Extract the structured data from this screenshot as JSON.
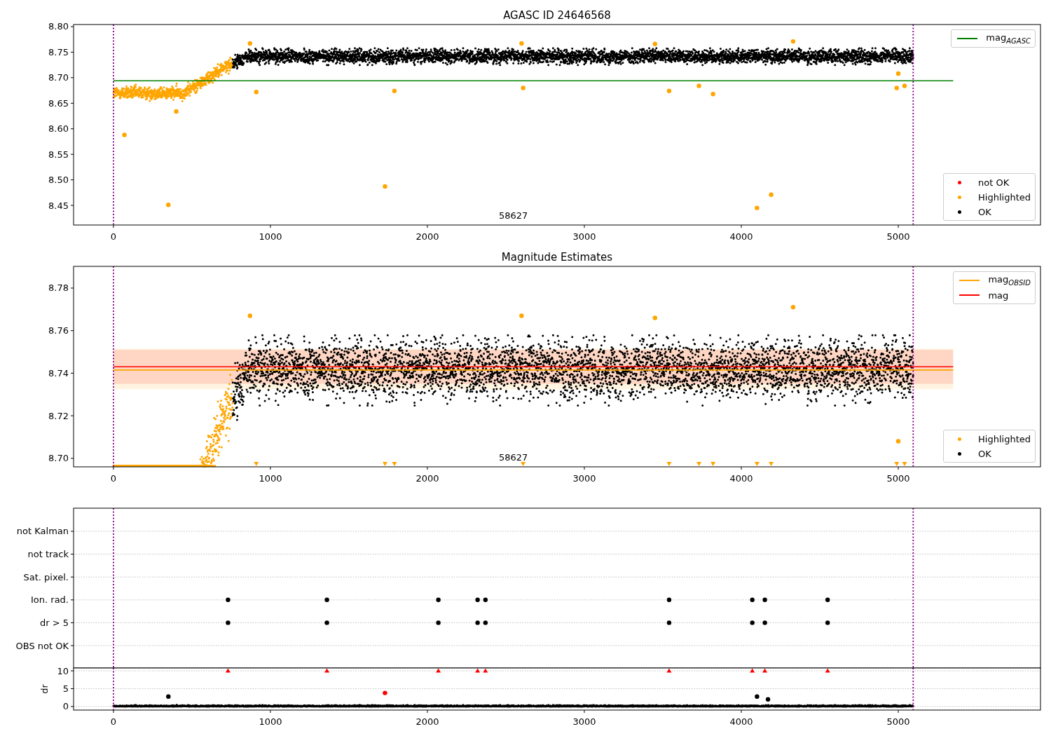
{
  "panels": [
    {
      "kind": "magnitude",
      "legends": [
        {
          "items": [
            {
              "kind": "line",
              "label": "mag$_{AGASC}$",
              "color": "#008000"
            }
          ]
        },
        {
          "items": [
            {
              "kind": "dot",
              "label": "not OK",
              "color": "#ff0000"
            },
            {
              "kind": "dot",
              "label": "Highlighted",
              "color": "#ffa500"
            },
            {
              "kind": "dot",
              "label": "OK",
              "color": "#000000"
            }
          ]
        }
      ],
      "charts": [
        {
          "kind": "magnitude",
          "chart_data": {
            "type": "scatter",
            "title": "AGASC ID 24646568",
            "xlim": [
              -254,
              5906
            ],
            "ylim": [
              8.4116,
              8.8041
            ],
            "xticks": [
              0,
              1000,
              2000,
              3000,
              4000,
              5000
            ],
            "yticks": [
              {
                "value": 8.45,
                "label": "8.45"
              },
              {
                "value": 8.5,
                "label": "8.50"
              },
              {
                "value": 8.55,
                "label": "8.55"
              },
              {
                "value": 8.6,
                "label": "8.60"
              },
              {
                "value": 8.65,
                "label": "8.65"
              },
              {
                "value": 8.7,
                "label": "8.70"
              },
              {
                "value": 8.75,
                "label": "8.75"
              },
              {
                "value": 8.8,
                "label": "8.80"
              }
            ],
            "x": [
              70,
              350,
              400,
              870,
              910,
              1730,
              1790,
              2600,
              2610,
              3450,
              3540,
              3730,
              3820,
              4100,
              4190,
              4330,
              4990,
              5000,
              5040
            ],
            "series": [
              {
                "color": "#ffa500",
                "values": [
                  8.588,
                  8.451,
                  8.634,
                  8.767,
                  8.672,
                  8.487,
                  8.674,
                  8.767,
                  8.68,
                  8.766,
                  8.674,
                  8.684,
                  8.668,
                  8.445,
                  8.471,
                  8.771,
                  8.68,
                  8.708,
                  8.684
                ]
              }
            ],
            "ref_lines": [
              {
                "axis": "y",
                "value": 8.694,
                "color": "#008000"
              },
              {
                "axis": "x",
                "value": 0,
                "color": "#800080"
              },
              {
                "axis": "x",
                "value": 5095,
                "color": "#800080"
              }
            ],
            "annotations": [
              "58627"
            ]
          }
        }
      ]
    },
    {
      "kind": "estimates",
      "legends": [
        {
          "items": [
            {
              "kind": "line",
              "label": "mag$_{OBSID}$",
              "color": "#ffa500"
            },
            {
              "kind": "line",
              "label": "mag",
              "color": "#ff0000"
            }
          ]
        },
        {
          "items": [
            {
              "kind": "dot",
              "label": "Highlighted",
              "color": "#ffa500"
            },
            {
              "kind": "dot",
              "label": "OK",
              "color": "#000000"
            }
          ]
        }
      ],
      "charts": [
        {
          "kind": "estimates",
          "chart_data": {
            "type": "scatter",
            "title": "Magnitude Estimates",
            "xlim": [
              -254,
              5906
            ],
            "ylim": [
              8.696,
              8.7902
            ],
            "xticks": [
              0,
              1000,
              2000,
              3000,
              4000,
              5000
            ],
            "yticks": [
              {
                "value": 8.7,
                "label": "8.70"
              },
              {
                "value": 8.72,
                "label": "8.72"
              },
              {
                "value": 8.74,
                "label": "8.74"
              },
              {
                "value": 8.76,
                "label": "8.76"
              },
              {
                "value": 8.78,
                "label": "8.78"
              }
            ],
            "x": [
              870,
              910,
              1730,
              1790,
              2600,
              2610,
              3450,
              3540,
              3730,
              3820,
              4100,
              4190,
              4330,
              4990,
              5000,
              5040
            ],
            "series": [
              {
                "color": "#ffa500",
                "values": [
                  8.767,
                  null,
                  null,
                  null,
                  8.767,
                  null,
                  8.766,
                  null,
                  null,
                  null,
                  null,
                  null,
                  8.771,
                  null,
                  8.708,
                  null
                ]
              },
              {
                "color": "#ffa500",
                "marker": "triangle",
                "values": [
                  null,
                  8.6975,
                  8.6975,
                  8.6975,
                  null,
                  8.6975,
                  null,
                  8.6975,
                  8.6975,
                  8.6975,
                  8.6975,
                  8.6975,
                  null,
                  8.6975,
                  null,
                  8.6975
                ]
              }
            ],
            "bands": [
              {
                "axis": "y",
                "from": 8.7325,
                "to": 8.7515,
                "color": "#ffa500"
              },
              {
                "axis": "y",
                "from": 8.735,
                "to": 8.751,
                "color": "#ff0000"
              }
            ],
            "ref_lines": [
              {
                "axis": "y",
                "value": 8.7415,
                "color": "#ffa500"
              },
              {
                "axis": "y",
                "value": 8.743,
                "color": "#ff0000"
              },
              {
                "axis": "x",
                "value": 0,
                "color": "#800080"
              },
              {
                "axis": "x",
                "value": 5095,
                "color": "#800080"
              }
            ],
            "annotations": [
              "58627"
            ]
          }
        }
      ]
    },
    {
      "kind": "flags",
      "charts": [
        {
          "kind": "flags",
          "chart_data": {
            "type": "scatter",
            "orientation": "horizontal",
            "xlim": [
              -254,
              5906
            ],
            "grid": true,
            "categories": [
              "not Kalman",
              "not track",
              "Sat. pixel.",
              "Ion. rad.",
              "dr > 5",
              "OBS not OK"
            ],
            "series": [
              {
                "color": "#000000",
                "values": [
                  null,
                  null,
                  null,
                  730,
                  730,
                  null
                ]
              },
              {
                "color": "#000000",
                "values": [
                  null,
                  null,
                  null,
                  1360,
                  1360,
                  null
                ]
              },
              {
                "color": "#000000",
                "values": [
                  null,
                  null,
                  null,
                  2070,
                  2070,
                  null
                ]
              },
              {
                "color": "#000000",
                "values": [
                  null,
                  null,
                  null,
                  2320,
                  2320,
                  null
                ]
              },
              {
                "color": "#000000",
                "values": [
                  null,
                  null,
                  null,
                  2370,
                  2370,
                  null
                ]
              },
              {
                "color": "#000000",
                "values": [
                  null,
                  null,
                  null,
                  3540,
                  3540,
                  null
                ]
              },
              {
                "color": "#000000",
                "values": [
                  null,
                  null,
                  null,
                  4070,
                  4070,
                  null
                ]
              },
              {
                "color": "#000000",
                "values": [
                  null,
                  null,
                  null,
                  4150,
                  4150,
                  null
                ]
              },
              {
                "color": "#000000",
                "values": [
                  null,
                  null,
                  null,
                  4550,
                  4550,
                  null
                ]
              }
            ],
            "ref_lines": [
              {
                "axis": "x",
                "value": 0,
                "color": "#800080"
              },
              {
                "axis": "x",
                "value": 5095,
                "color": "#800080"
              }
            ]
          }
        },
        {
          "kind": "dr",
          "chart_data": {
            "type": "scatter",
            "ylabel": "dr",
            "xlim": [
              -254,
              5906
            ],
            "ylim": [
              -1,
              10.8
            ],
            "grid": true,
            "xticks": [
              0,
              1000,
              2000,
              3000,
              4000,
              5000
            ],
            "yticks": [
              0,
              5,
              10
            ],
            "x": [
              350,
              730,
              1360,
              1730,
              2070,
              2320,
              2370,
              3540,
              4070,
              4100,
              4150,
              4170,
              4550
            ],
            "series": [
              {
                "color": "#000000",
                "values": [
                  2.8,
                  null,
                  null,
                  null,
                  null,
                  null,
                  null,
                  null,
                  null,
                  2.8,
                  null,
                  2.0,
                  null
                ]
              },
              {
                "color": "#ff0000",
                "values": [
                  null,
                  null,
                  null,
                  3.8,
                  null,
                  null,
                  null,
                  null,
                  null,
                  null,
                  null,
                  null,
                  null
                ]
              },
              {
                "color": "#ff0000",
                "marker": "triangle",
                "values": [
                  null,
                  10,
                  10,
                  null,
                  10,
                  10,
                  10,
                  10,
                  10,
                  null,
                  10,
                  null,
                  10
                ]
              }
            ],
            "ref_lines": [
              {
                "axis": "x",
                "value": 0,
                "color": "#800080"
              },
              {
                "axis": "x",
                "value": 5095,
                "color": "#800080"
              }
            ]
          }
        }
      ]
    }
  ]
}
